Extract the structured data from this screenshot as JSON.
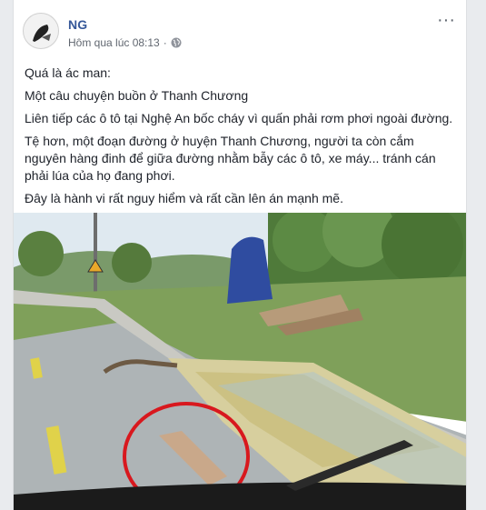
{
  "post": {
    "author": "NG",
    "timestamp": "Hôm qua lúc 08:13",
    "separator": "·",
    "privacy_icon": "globe-icon",
    "more_icon": "more-options-icon",
    "paragraphs": [
      "Quá là ác man:",
      "Một câu chuyện buồn ở Thanh Chương",
      "Liên tiếp các ô tô tại Nghệ An bốc cháy vì quấn phải rơm phơi ngoài đường.",
      "Tệ hơn, một đoạn đường ở huyện Thanh Chương, người ta còn cắm nguyên hàng đinh để giữa đường nhằm bẫy các ô tô, xe máy... tránh cán phải lúa của họ đang phơi.",
      "Đây là hành vi rất nguy hiểm và rất cần lên án mạnh mẽ."
    ]
  },
  "colors": {
    "link": "#365899",
    "meta": "#616770",
    "text": "#1d2129",
    "highlight_circle": "#d8181e"
  }
}
